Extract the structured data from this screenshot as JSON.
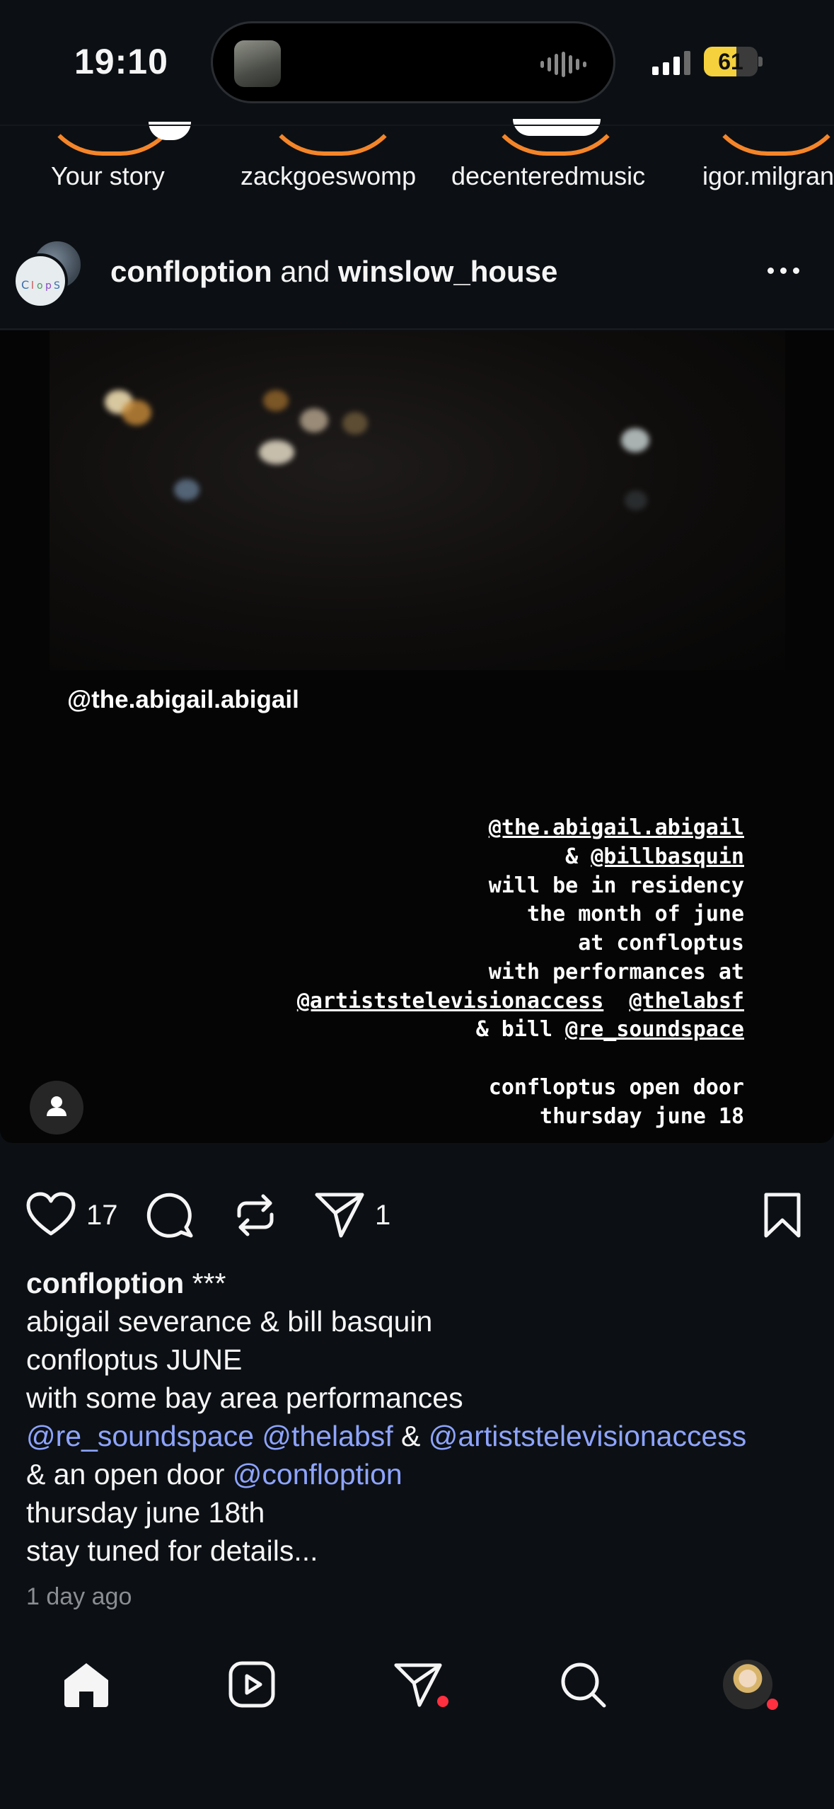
{
  "status_bar": {
    "time": "19:10",
    "battery_level": "61",
    "battery_fraction": 0.61
  },
  "stories": [
    {
      "label": "Your story"
    },
    {
      "label": "zackgoeswomp"
    },
    {
      "label": "decenteredmusic"
    },
    {
      "label": "igor.milgran"
    }
  ],
  "post": {
    "author_primary": "confloption",
    "author_join": " and ",
    "author_secondary": "winslow_house",
    "media": {
      "overlay_tag": "@the.abigail.abigail",
      "flyer_lines": {
        "l1": "@the.abigail.abigail",
        "l2_prefix": "& ",
        "l2_mention": "@billbasquin",
        "l3": "will be in residency",
        "l4": "the month of june",
        "l5": "at confloptus",
        "l6": "with performances at",
        "l7a": "@artiststelevisionaccess",
        "l7b": "@thelabsf",
        "l8_prefix": "& bill ",
        "l8_mention": "@re_soundspace",
        "l9": "confloptus open door",
        "l10": "thursday june 18"
      }
    },
    "actions": {
      "likes": "17",
      "shares": "1"
    },
    "caption": {
      "username": "confloption",
      "username_suffix": " ***",
      "line1": "abigail severance & bill basquin",
      "line2": "confloptus JUNE",
      "line3": "with some bay area performances",
      "line4_m1": "@re_soundspace",
      "line4_m2": "@thelabsf",
      "line4_amp": " & ",
      "line4_m3": "@artiststelevisionaccess",
      "line5_prefix": "& an open door ",
      "line5_mention": "@confloption",
      "line6": "thursday june 18th",
      "line7": "stay tuned for details..."
    },
    "time_ago": "1 day ago"
  },
  "bottom_nav": [
    {
      "name": "home",
      "icon": "home-icon"
    },
    {
      "name": "reels",
      "icon": "reels-icon"
    },
    {
      "name": "messages",
      "icon": "direct-send-icon"
    },
    {
      "name": "search",
      "icon": "search-icon"
    },
    {
      "name": "profile",
      "icon": "avatar"
    }
  ],
  "colors": {
    "background": "#0c1014",
    "mention": "#8ea4ff",
    "notification": "#ff3040",
    "story_ring": "#f58529"
  }
}
